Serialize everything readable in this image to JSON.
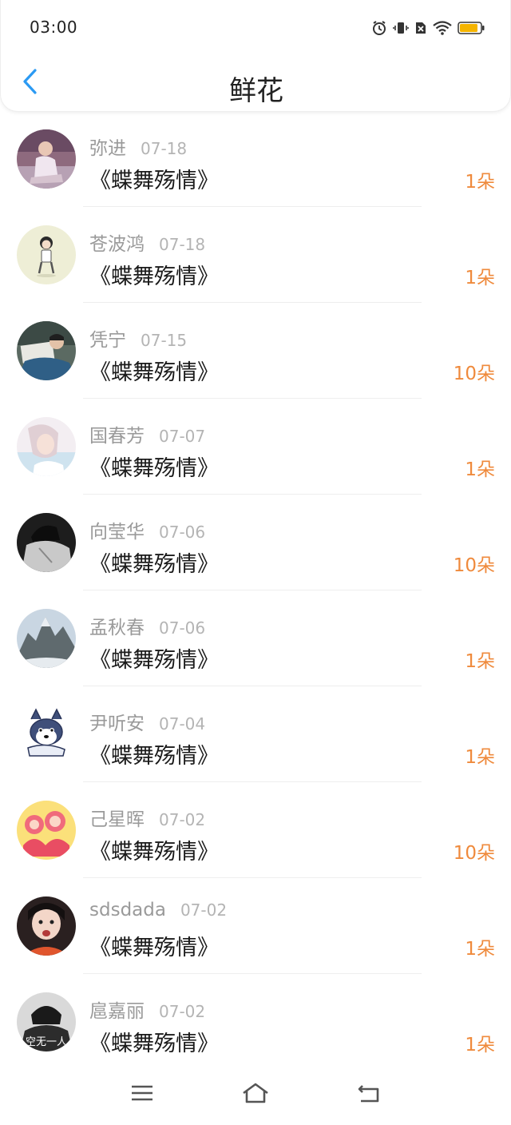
{
  "status_bar": {
    "time": "03:00",
    "icons": [
      "alarm-icon",
      "vibrate-icon",
      "no-sim-icon",
      "wifi-icon",
      "battery-icon"
    ],
    "battery_color": "#f5b400"
  },
  "header": {
    "title": "鲜花",
    "back_icon": "back-chevron-icon",
    "accent_color": "#2b9af3"
  },
  "gifts": [
    {
      "name": "弥进",
      "date": "07-18",
      "work": "《蝶舞殇情》",
      "count": "1朵"
    },
    {
      "name": "苍波鸿",
      "date": "07-18",
      "work": "《蝶舞殇情》",
      "count": "1朵"
    },
    {
      "name": "凭宁",
      "date": "07-15",
      "work": "《蝶舞殇情》",
      "count": "10朵"
    },
    {
      "name": "国春芳",
      "date": "07-07",
      "work": "《蝶舞殇情》",
      "count": "1朵"
    },
    {
      "name": "向莹华",
      "date": "07-06",
      "work": "《蝶舞殇情》",
      "count": "10朵"
    },
    {
      "name": "孟秋春",
      "date": "07-06",
      "work": "《蝶舞殇情》",
      "count": "1朵"
    },
    {
      "name": "尹听安",
      "date": "07-04",
      "work": "《蝶舞殇情》",
      "count": "1朵"
    },
    {
      "name": "己星晖",
      "date": "07-02",
      "work": "《蝶舞殇情》",
      "count": "10朵"
    },
    {
      "name": "sdsdada",
      "date": "07-02",
      "work": "《蝶舞殇情》",
      "count": "1朵"
    },
    {
      "name": "扈嘉丽",
      "date": "07-02",
      "work": "《蝶舞殇情》",
      "count": "1朵"
    }
  ],
  "avatar_text": {
    "last": "空无一人"
  },
  "colors": {
    "count": "#ef8a3c",
    "name": "#9a9a9a",
    "date": "#b4b4b4",
    "title": "#1a1a1a"
  },
  "bottom_nav": {
    "icons": [
      "menu-icon",
      "home-icon",
      "back-icon"
    ]
  }
}
